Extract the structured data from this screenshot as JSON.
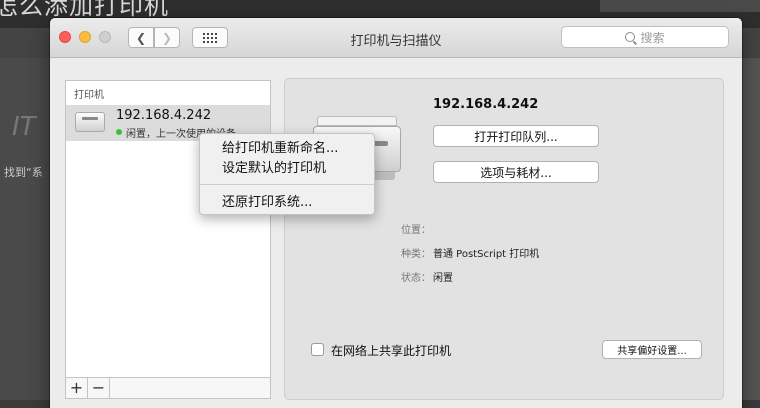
{
  "background": {
    "page_title": "怎么添加打印机",
    "snippet": "找到“系"
  },
  "window": {
    "title": "打印机与扫描仪",
    "search_placeholder": "搜索",
    "back_glyph": "❮",
    "forward_glyph": "❯"
  },
  "sidebar": {
    "header": "打印机",
    "items": [
      {
        "name": "192.168.4.242",
        "status": "闲置，上一次使用的设备",
        "status_color": "#3cc03c"
      }
    ],
    "add_label": "+",
    "remove_label": "−"
  },
  "detail": {
    "printer_name": "192.168.4.242",
    "open_queue_label": "打开打印队列...",
    "options_label": "选项与耗材...",
    "location_label": "位置：",
    "location_value": "",
    "kind_label": "种类：",
    "kind_value": "普通 PostScript 打印机",
    "status_label": "状态：",
    "status_value": "闲置",
    "share_label": "在网络上共享此打印机",
    "share_checked": false,
    "share_prefs_label": "共享偏好设置..."
  },
  "context_menu": {
    "items": [
      "给打印机重新命名...",
      "设定默认的打印机",
      "还原打印系统..."
    ]
  },
  "colors": {
    "close": "#fc605c",
    "minimize": "#fdbc40",
    "zoom_disabled": "#cfcfcf"
  }
}
